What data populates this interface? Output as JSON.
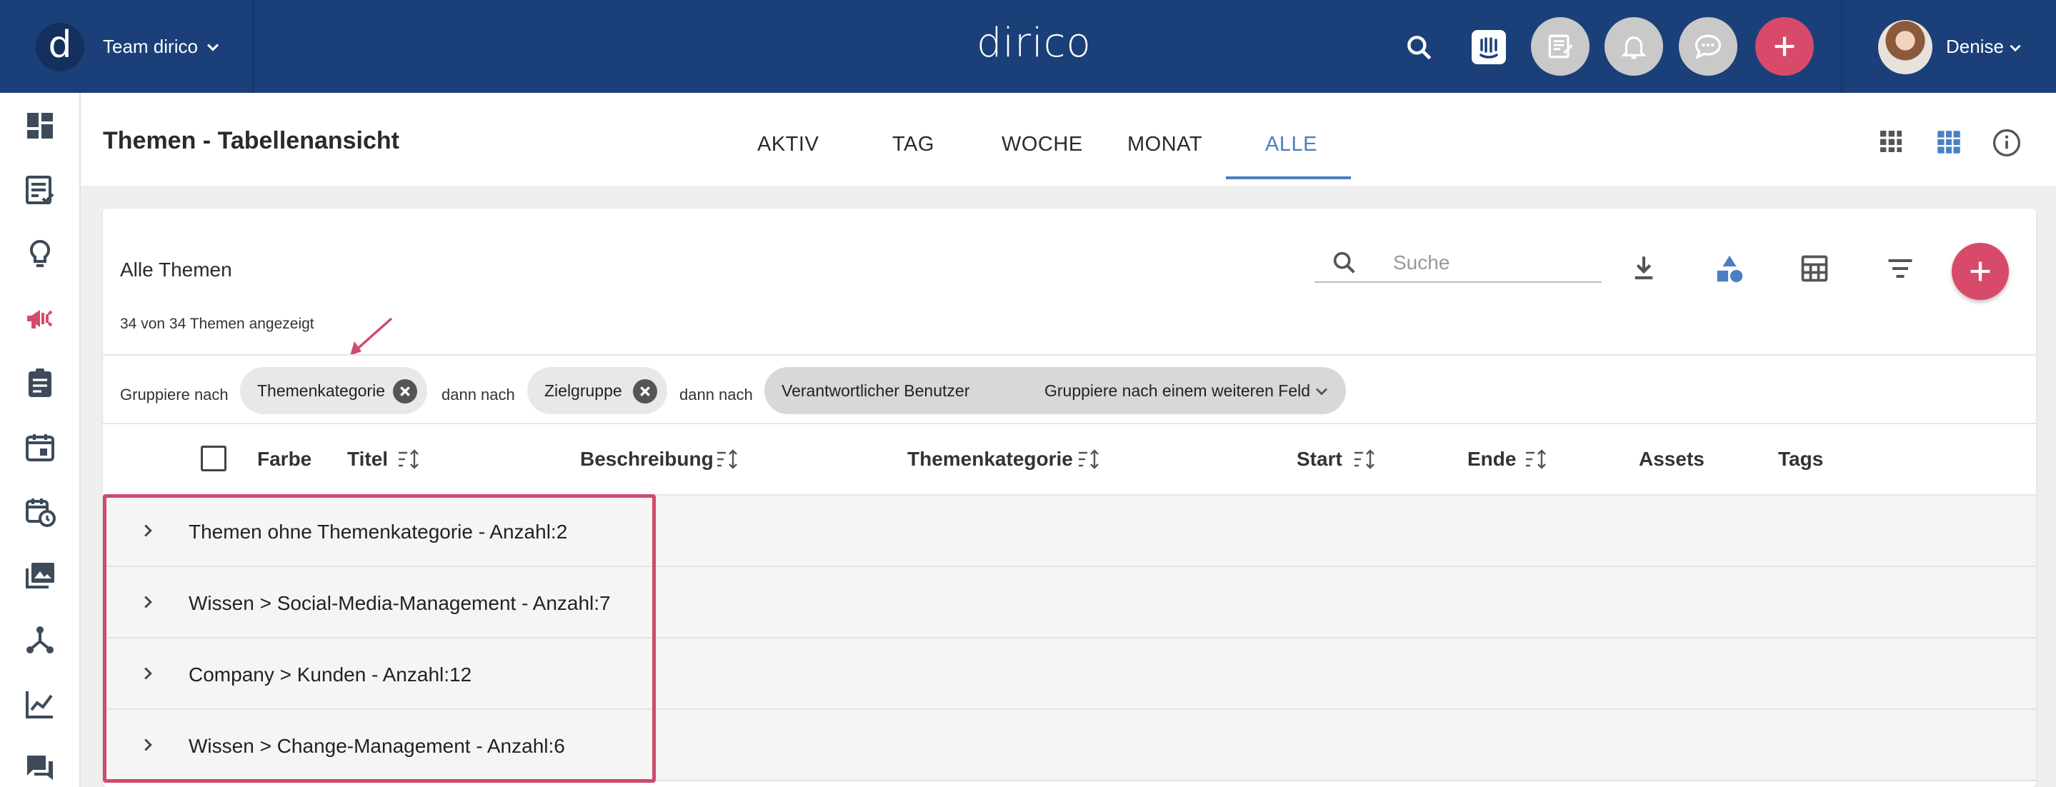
{
  "topbar": {
    "team": "Team dirico",
    "brand": "dirico",
    "username": "Denise",
    "colors": {
      "bg": "#1b3f78",
      "accent": "#d84a6a"
    },
    "icons": [
      "search-icon",
      "intercom-icon",
      "notes-icon",
      "bell-icon",
      "chat-icon",
      "plus-icon",
      "chevron-down-icon"
    ]
  },
  "sidebar": {
    "items": [
      "dashboard-icon",
      "tasks-icon",
      "ideas-icon",
      "campaign-icon",
      "assignment-icon",
      "calendar-icon",
      "schedule-icon",
      "media-icon",
      "workflow-icon",
      "analytics-icon",
      "comments-icon"
    ]
  },
  "header": {
    "title": "Themen - Tabellenansicht",
    "tabs": [
      {
        "label": "AKTIV",
        "active": false
      },
      {
        "label": "TAG",
        "active": false
      },
      {
        "label": "WOCHE",
        "active": false
      },
      {
        "label": "MONAT",
        "active": false
      },
      {
        "label": "ALLE",
        "active": true
      }
    ]
  },
  "card": {
    "title": "Alle Themen",
    "count": "34 von 34 Themen angezeigt",
    "search": {
      "placeholder": "Suche",
      "value": ""
    },
    "tools": [
      "download-icon",
      "shapes-icon",
      "table-config-icon",
      "filter-icon",
      "add-icon"
    ]
  },
  "grouping": {
    "label": "Gruppiere nach",
    "then": "dann nach",
    "chips": [
      "Themenkategorie",
      "Zielgruppe",
      "Verantwortlicher Benutzer"
    ],
    "add_more": "Gruppiere nach einem weiteren Feld"
  },
  "table": {
    "columns": [
      "Farbe",
      "Titel",
      "Beschreibung",
      "Themenkategorie",
      "Start",
      "Ende",
      "Assets",
      "Tags"
    ],
    "groups": [
      "Themen ohne Themenkategorie  -  Anzahl:2",
      "Wissen > Social-Media-Management  -  Anzahl:7",
      "Company > Kunden  -  Anzahl:12",
      "Wissen > Change-Management  -  Anzahl:6"
    ]
  }
}
